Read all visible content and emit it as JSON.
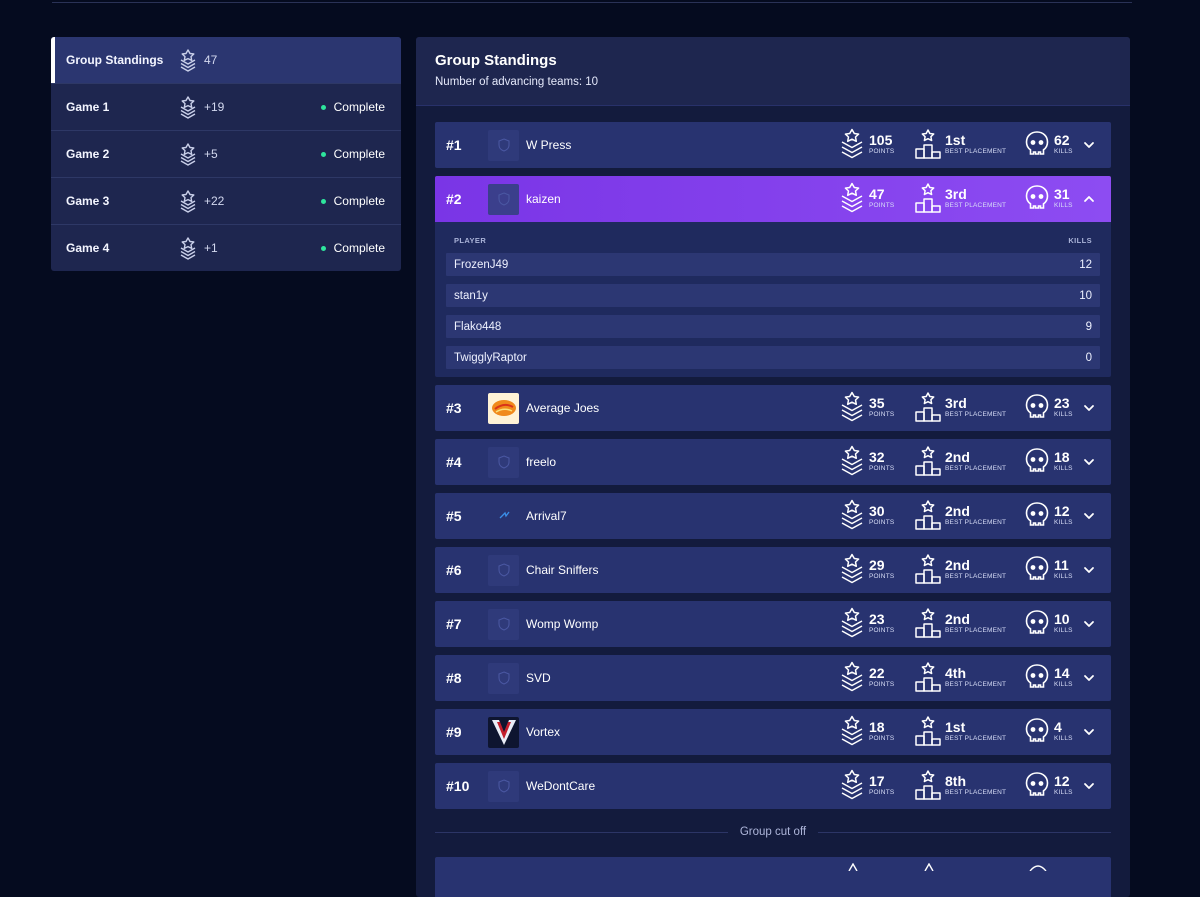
{
  "sidebar": {
    "items": [
      {
        "label": "Group Standings",
        "points": "47",
        "status": ""
      },
      {
        "label": "Game 1",
        "points": "+19",
        "status": "Complete"
      },
      {
        "label": "Game 2",
        "points": "+5",
        "status": "Complete"
      },
      {
        "label": "Game 3",
        "points": "+22",
        "status": "Complete"
      },
      {
        "label": "Game 4",
        "points": "+1",
        "status": "Complete"
      }
    ]
  },
  "header": {
    "title": "Group Standings",
    "subtitle": "Number of advancing teams: 10"
  },
  "captions": {
    "points": "POINTS",
    "placement": "BEST PLACEMENT",
    "kills": "KILLS"
  },
  "teams": [
    {
      "rank": "#1",
      "name": "W Press",
      "points": "105",
      "placement": "1st",
      "kills": "62"
    },
    {
      "rank": "#2",
      "name": "kaizen",
      "points": "47",
      "placement": "3rd",
      "kills": "31"
    },
    {
      "rank": "#3",
      "name": "Average Joes",
      "points": "35",
      "placement": "3rd",
      "kills": "23"
    },
    {
      "rank": "#4",
      "name": "freelo",
      "points": "32",
      "placement": "2nd",
      "kills": "18"
    },
    {
      "rank": "#5",
      "name": "Arrival7",
      "points": "30",
      "placement": "2nd",
      "kills": "12"
    },
    {
      "rank": "#6",
      "name": "Chair Sniffers",
      "points": "29",
      "placement": "2nd",
      "kills": "11"
    },
    {
      "rank": "#7",
      "name": "Womp Womp",
      "points": "23",
      "placement": "2nd",
      "kills": "10"
    },
    {
      "rank": "#8",
      "name": "SVD",
      "points": "22",
      "placement": "4th",
      "kills": "14"
    },
    {
      "rank": "#9",
      "name": "Vortex",
      "points": "18",
      "placement": "1st",
      "kills": "4"
    },
    {
      "rank": "#10",
      "name": "WeDontCare",
      "points": "17",
      "placement": "8th",
      "kills": "12"
    }
  ],
  "expanded": {
    "team": "kaizen",
    "columns": {
      "player": "PLAYER",
      "kills": "KILLS"
    },
    "players": [
      {
        "name": "FrozenJ49",
        "kills": "12"
      },
      {
        "name": "stan1y",
        "kills": "10"
      },
      {
        "name": "Flako448",
        "kills": "9"
      },
      {
        "name": "TwigglyRaptor",
        "kills": "0"
      }
    ]
  },
  "cutoff_label": "Group cut off",
  "colors": {
    "accent": "#8d4cf2",
    "status_complete": "#2ee59d",
    "row": "#283370",
    "background": "#050b1f"
  },
  "icons": {
    "points": "rank-chevrons-icon",
    "placement": "podium-star-icon",
    "kills": "skull-icon",
    "expand": "chevron-down-icon",
    "collapse": "chevron-up-icon"
  }
}
